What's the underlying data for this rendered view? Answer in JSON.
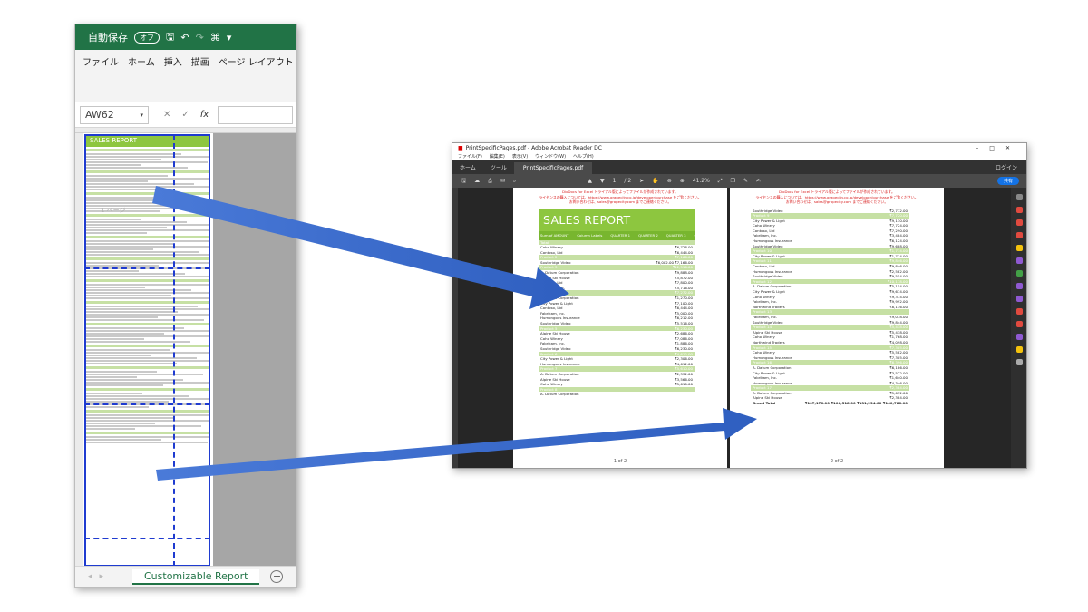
{
  "excel": {
    "autosave_label": "自動保存",
    "autosave_state": "オフ",
    "ribbon_tabs": [
      "ファイル",
      "ホーム",
      "挿入",
      "描画",
      "ページ レイアウト"
    ],
    "name_box": "AW62",
    "fx_label": "fx",
    "sheet_tab": "Customizable Report",
    "watermark": "1 ページ",
    "mini_report_title": "SALES REPORT"
  },
  "pdf": {
    "window_title": "PrintSpecificPages.pdf - Adobe Acrobat Reader DC",
    "menu": [
      "ファイル(F)",
      "編集(E)",
      "表示(V)",
      "ウィンドウ(W)",
      "ヘルプ(H)"
    ],
    "tabs": {
      "home": "ホーム",
      "tools": "ツール",
      "document": "PrintSpecificPages.pdf",
      "signin": "ログイン"
    },
    "toolbar": {
      "page_current": "1",
      "page_total": "/ 2",
      "zoom": "41.2%",
      "share": "共有"
    },
    "notice_lines": [
      "DioDocs for Excel トライアル版によってファイルが作成されています。",
      "ライセンスの購入については、https://www.grapecity.co.jp/developer/purchase をご覧ください。",
      "お問い合わせは、sales@grapecity.com までご連絡ください。"
    ],
    "page1": {
      "title": "SALES REPORT",
      "header": [
        "Sum of AMOUNT",
        "Column Labels",
        "Row Labels",
        "QUARTER 1",
        "QUARTER 2",
        "QUARTER 3",
        "QUARTER 4"
      ],
      "rows": [
        {
          "label": "Total",
          "value": "",
          "group": true
        },
        {
          "label": "Coho Winery",
          "value": "₹6,728.00",
          "group": false
        },
        {
          "label": "Contoso, Ltd",
          "value": "₹6,444.00",
          "group": false
        },
        {
          "label": "Product 2",
          "value": "₹7,166.00",
          "group": true
        },
        {
          "label": "Southridge Video",
          "value": "₹6,002.00   ₹7,166.00",
          "group": false
        },
        {
          "label": "Product 3",
          "value": "₹12,516.00",
          "group": true
        },
        {
          "label": "A. Datum Corporation",
          "value": "₹9,888.00",
          "group": false
        },
        {
          "label": "Alpine Ski House",
          "value": "₹5,872.00",
          "group": false
        },
        {
          "label": "Contoso, Ltd",
          "value": "₹7,800.00",
          "group": false
        },
        {
          "label": "Fabrikam, Inc.",
          "value": "₹5,716.00",
          "group": false
        },
        {
          "label": "Product 4",
          "value": "₹7,272.00",
          "group": true
        },
        {
          "label": "A. Datum Corporation",
          "value": "₹1,270.00",
          "group": false
        },
        {
          "label": "City Power & Light",
          "value": "₹7,100.00",
          "group": false
        },
        {
          "label": "Contoso, Ltd",
          "value": "₹6,444.00",
          "group": false
        },
        {
          "label": "Fabrikam, Inc.",
          "value": "₹5,000.00",
          "group": false
        },
        {
          "label": "Humongous Insurance",
          "value": "₹6,212.00",
          "group": false
        },
        {
          "label": "Southridge Video",
          "value": "₹5,516.00",
          "group": false
        },
        {
          "label": "Product 5",
          "value": "₹6,230.00",
          "group": true
        },
        {
          "label": "Alpine Ski House",
          "value": "₹2,686.00",
          "group": false
        },
        {
          "label": "Coho Winery",
          "value": "₹7,086.00",
          "group": false
        },
        {
          "label": "Fabrikam, Inc.",
          "value": "₹1,886.00",
          "group": false
        },
        {
          "label": "Southridge Video",
          "value": "₹6,230.00",
          "group": false
        },
        {
          "label": "Product 6",
          "value": "₹4,612.00",
          "group": true
        },
        {
          "label": "City Power & Light",
          "value": "₹2,306.00",
          "group": false
        },
        {
          "label": "Humongous Insurance",
          "value": "₹4,612.00",
          "group": false
        },
        {
          "label": "Product 7",
          "value": "₹5,610.00",
          "group": true
        },
        {
          "label": "A. Datum Corporation",
          "value": "₹2,332.00",
          "group": false
        },
        {
          "label": "Alpine Ski House",
          "value": "₹3,566.00",
          "group": false
        },
        {
          "label": "Coho Winery",
          "value": "₹5,610.00",
          "group": false
        },
        {
          "label": "Product 8",
          "value": "",
          "group": true
        },
        {
          "label": "A. Datum Corporation",
          "value": "",
          "group": false
        }
      ],
      "page_label": "1 of 2"
    },
    "page2": {
      "rows": [
        {
          "label": "Southridge Video",
          "value": "₹2,772.00",
          "group": false
        },
        {
          "label": "Product 9",
          "value": "₹7,720.00",
          "group": true
        },
        {
          "label": "City Power & Light",
          "value": "₹9,130.00",
          "group": false
        },
        {
          "label": "Coho Winery",
          "value": "₹7,724.00",
          "group": false
        },
        {
          "label": "Contoso, Ltd",
          "value": "₹7,290.00",
          "group": false
        },
        {
          "label": "Fabrikam, Inc.",
          "value": "₹3,484.00",
          "group": false
        },
        {
          "label": "Humongous Insurance",
          "value": "₹6,124.00",
          "group": false
        },
        {
          "label": "Southridge Video",
          "value": "₹9,688.00",
          "group": false
        },
        {
          "label": "Product 10",
          "value": "₹1,714.00",
          "group": true
        },
        {
          "label": "City Power & Light",
          "value": "₹1,714.00",
          "group": false
        },
        {
          "label": "Product 11",
          "value": "₹9,846.00",
          "group": true
        },
        {
          "label": "Contoso, Ltd",
          "value": "₹9,846.00",
          "group": false
        },
        {
          "label": "Humongous Insurance",
          "value": "₹2,582.00",
          "group": false
        },
        {
          "label": "Southridge Video",
          "value": "₹9,554.00",
          "group": false
        },
        {
          "label": "Product 12",
          "value": "₹10,178.00",
          "group": true
        },
        {
          "label": "A. Datum Corporation",
          "value": "₹5,154.00",
          "group": false
        },
        {
          "label": "City Power & Light",
          "value": "₹9,674.00",
          "group": false
        },
        {
          "label": "Coho Winery",
          "value": "₹9,374.00",
          "group": false
        },
        {
          "label": "Fabrikam, Inc.",
          "value": "₹9,992.00",
          "group": false
        },
        {
          "label": "Northwind Traders",
          "value": "₹8,136.00",
          "group": false
        },
        {
          "label": "Product 13",
          "value": "",
          "group": true
        },
        {
          "label": "Fabrikam, Inc.",
          "value": "₹9,078.00",
          "group": false
        },
        {
          "label": "Southridge Video",
          "value": "₹9,844.00",
          "group": false
        },
        {
          "label": "Product 14",
          "value": "₹5,438.00",
          "group": true
        },
        {
          "label": "Alpine Ski House",
          "value": "₹5,438.00",
          "group": false
        },
        {
          "label": "Coho Winery",
          "value": "₹1,768.00",
          "group": false
        },
        {
          "label": "Northwind Traders",
          "value": "₹4,098.00",
          "group": false
        },
        {
          "label": "Product 15",
          "value": "₹7,305.00",
          "group": true
        },
        {
          "label": "Coho Winery",
          "value": "₹5,582.00",
          "group": false
        },
        {
          "label": "Humongous Insurance",
          "value": "₹7,305.00",
          "group": false
        },
        {
          "label": "Product 16",
          "value": "₹6,396.00",
          "group": true
        },
        {
          "label": "A. Datum Corporation",
          "value": "₹6,186.00",
          "group": false
        },
        {
          "label": "City Power & Light",
          "value": "₹3,522.00",
          "group": false
        },
        {
          "label": "Fabrikam, Inc.",
          "value": "₹1,640.00",
          "group": false
        },
        {
          "label": "Humongous Insurance",
          "value": "₹4,346.00",
          "group": false
        },
        {
          "label": "Product 17",
          "value": "₹2,384.00",
          "group": true
        },
        {
          "label": "A. Datum Corporation",
          "value": "₹5,652.00",
          "group": false
        },
        {
          "label": "Alpine Ski House",
          "value": "₹2,384.00",
          "group": false
        }
      ],
      "grand_total_label": "Grand Total",
      "grand_total_values": "₹107,176.00   ₹106,518.00   ₹131,234.00   ₹140,786.00",
      "page_label": "2 of 2"
    }
  },
  "colors": {
    "excel_green": "#217346",
    "report_green": "#8dc63f",
    "arrow_blue": "#3e6fd1",
    "pagebreak_blue": "#1f3bd0"
  }
}
